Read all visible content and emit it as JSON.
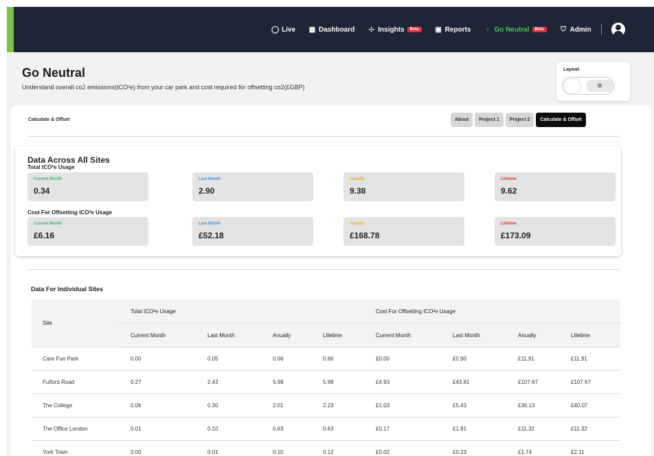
{
  "nav": {
    "items": [
      {
        "label": "Live",
        "icon": "circle-icon",
        "glyph": "◯"
      },
      {
        "label": "Dashboard",
        "icon": "grid-icon",
        "glyph": "▦"
      },
      {
        "label": "Insights",
        "icon": "crosshair-icon",
        "glyph": "⊹",
        "badge": "Beta"
      },
      {
        "label": "Reports",
        "icon": "report-icon",
        "glyph": "▣"
      },
      {
        "label": "Go Neutral",
        "icon": "bulb-icon",
        "glyph": "♁",
        "badge": "Beta",
        "active": true
      },
      {
        "label": "Admin",
        "icon": "shield-icon",
        "glyph": "⛉"
      }
    ],
    "active_color": "#4cc35e"
  },
  "page": {
    "title": "Go Neutral",
    "subtitle": "Understand overall co2 emissions(tCO²e) from your car park and cost required for offsetting co2(£GBP)"
  },
  "layout": {
    "label": "Layout",
    "icon_glyph": "≡"
  },
  "section": {
    "label": "Calculate & Offset",
    "tabs": [
      "About",
      "Project 1",
      "Project 2",
      "Calculate & Offset"
    ],
    "active_tab": "Calculate & Offset"
  },
  "summary": {
    "title": "Data Across All Sites",
    "usage_label": "Total tCO²e Usage",
    "cost_label": "Cost For Offsetting tCO²e Usage",
    "usage": [
      {
        "label": "Current Month",
        "value": "0.34"
      },
      {
        "label": "Last Month",
        "value": "2.90"
      },
      {
        "label": "Anually",
        "value": "9.38"
      },
      {
        "label": "Lifetime",
        "value": "9.62"
      }
    ],
    "cost": [
      {
        "label": "Current Month",
        "value": "£6.16"
      },
      {
        "label": "Last Month",
        "value": "£52.18"
      },
      {
        "label": "Anually",
        "value": "£168.78"
      },
      {
        "label": "Lifetime",
        "value": "£173.09"
      }
    ]
  },
  "individual": {
    "title": "Data For Individual Sites",
    "site_header": "Site",
    "group_usage": "Total tCO²e Usage",
    "group_cost": "Cost For Offsetting tCO²e Usage",
    "columns": [
      "Current Month",
      "Last Month",
      "Anually",
      "Lifetime",
      "Current Month",
      "Last Month",
      "Anually",
      "Lifetime"
    ],
    "rows": [
      {
        "site": "Care Fun Park",
        "cells": [
          "0.00",
          "0.05",
          "0.66",
          "0.66",
          "£0.00",
          "£0.90",
          "£11.91",
          "£11.91"
        ]
      },
      {
        "site": "Fulford Road",
        "cells": [
          "0.27",
          "2.43",
          "5.98",
          "5.98",
          "£4.93",
          "£43.81",
          "£107.67",
          "£107.67"
        ]
      },
      {
        "site": "The College",
        "cells": [
          "0.06",
          "0.30",
          "2.01",
          "2.23",
          "£1.03",
          "£5.43",
          "£36.13",
          "£40.07"
        ]
      },
      {
        "site": "The Office London",
        "cells": [
          "0.01",
          "0.10",
          "0.63",
          "0.63",
          "£0.17",
          "£1.81",
          "£11.32",
          "£11.32"
        ]
      },
      {
        "site": "York Town",
        "cells": [
          "0.00",
          "0.01",
          "0.10",
          "0.12",
          "£0.02",
          "£0.23",
          "£1.74",
          "£2.11"
        ]
      }
    ]
  }
}
